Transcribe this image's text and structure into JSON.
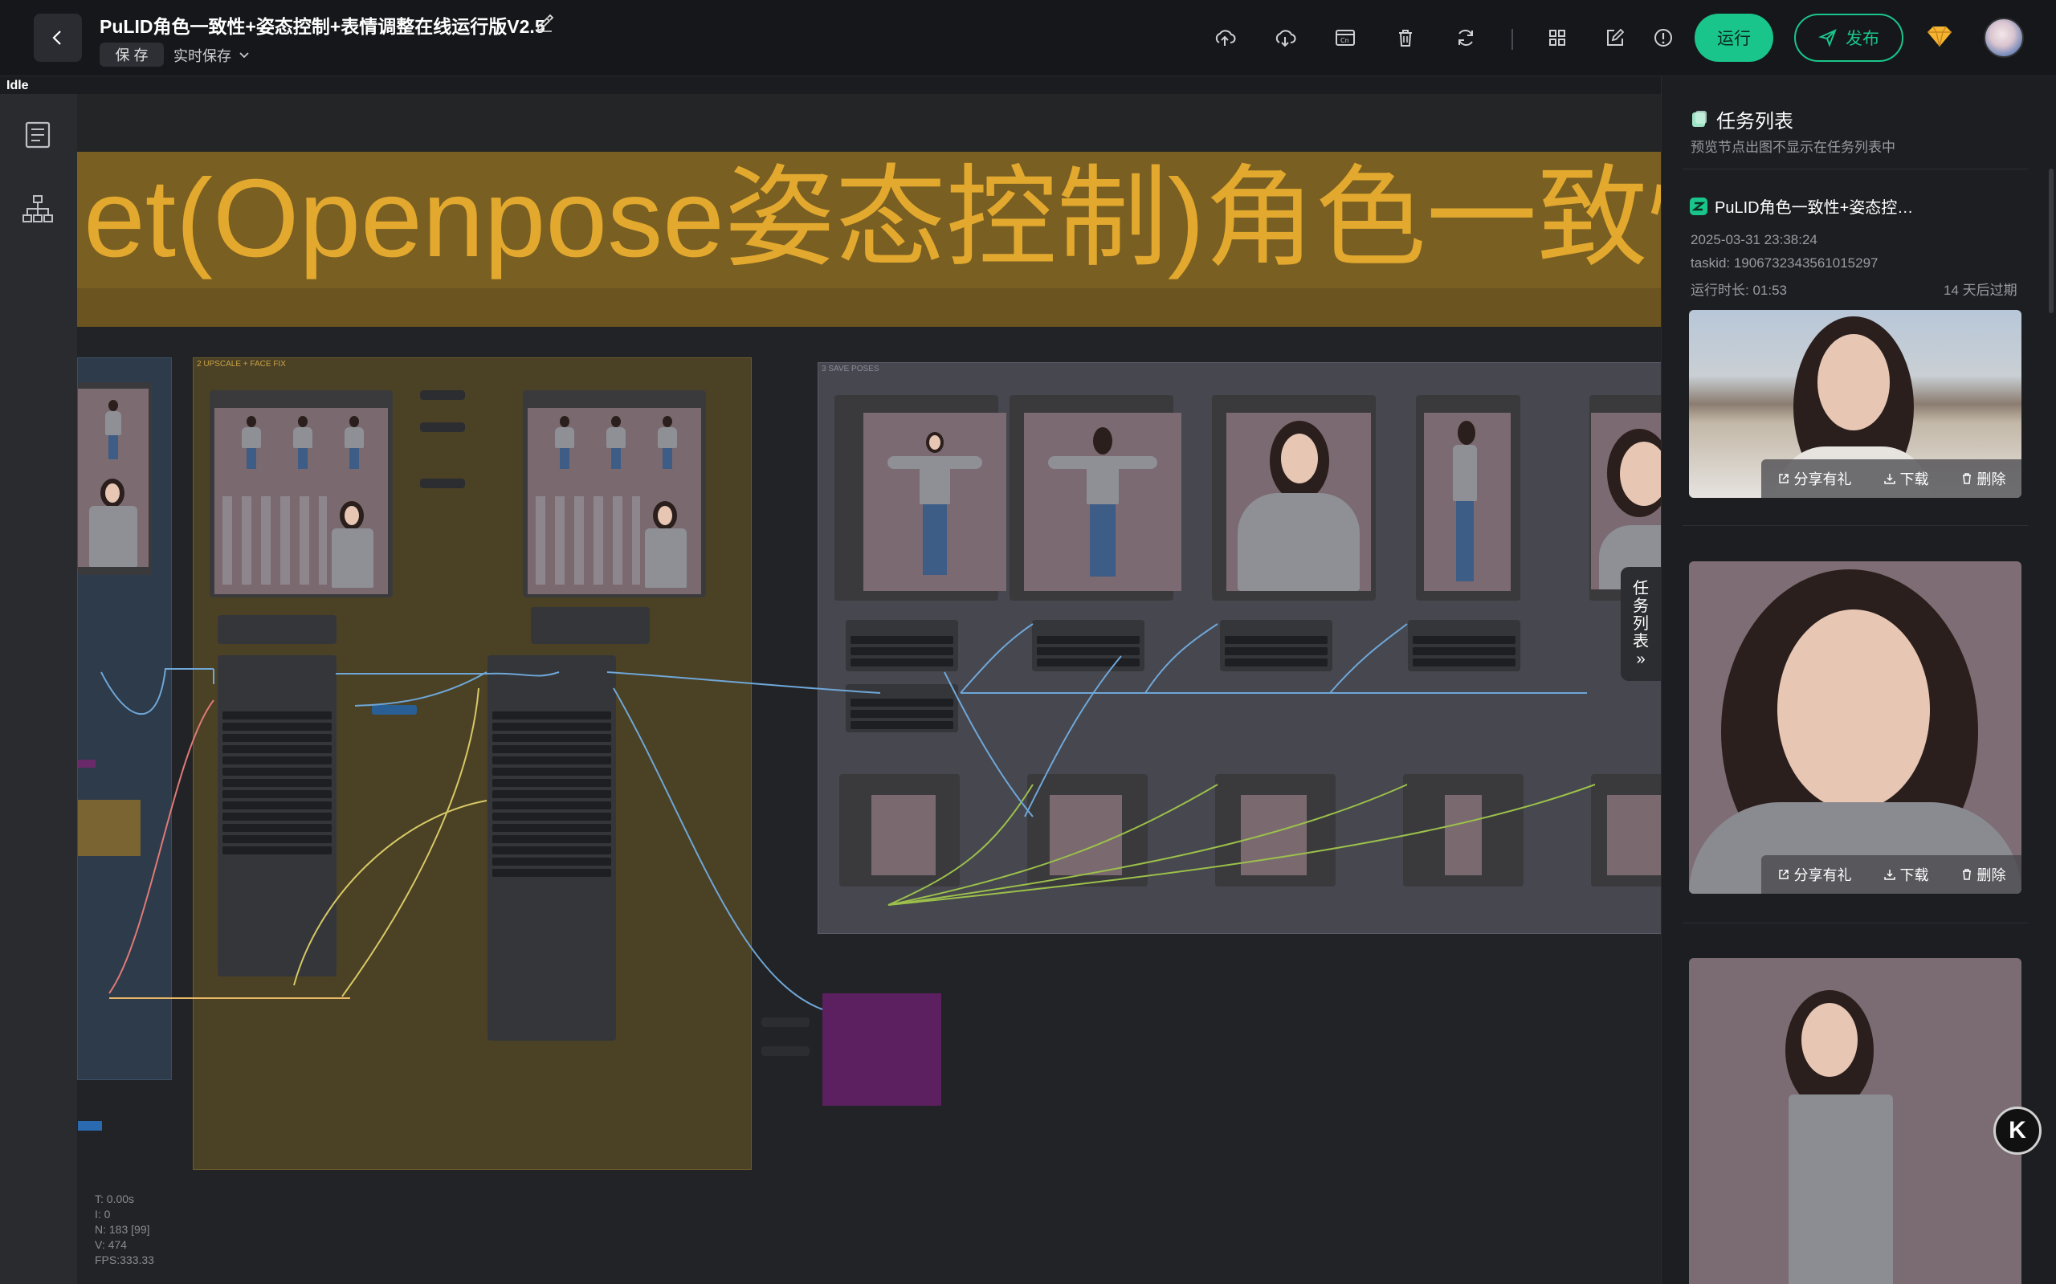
{
  "header": {
    "title": "PuLID角色一致性+姿态控制+表情调整在线运行版V2.5",
    "save_label": "保 存",
    "autosave_label": "实时保存",
    "run_label": "运行",
    "publish_label": "发布"
  },
  "status": {
    "idle": "Idle"
  },
  "canvas": {
    "banner_text": "et(Openpose姿态控制)角色一致性文",
    "group_upscale": "2 UPSCALE + FACE FIX",
    "group_save": "3 SAVE POSES",
    "stats": [
      "T: 0.00s",
      "I: 0",
      "N: 183 [99]",
      "V: 474",
      "FPS:333.33"
    ]
  },
  "task_toggle": {
    "label": [
      "任",
      "务",
      "列",
      "表",
      "»"
    ]
  },
  "panel": {
    "title": "任务列表",
    "subtitle": "预览节点出图不显示在任务列表中",
    "task": {
      "name": "PuLID角色一致性+姿态控…",
      "date": "2025-03-31 23:38:24",
      "taskid": "taskid: 1906732343561015297",
      "duration": "运行时长: 01:53",
      "expire": "14 天后过期"
    },
    "actions": {
      "share": "分享有礼",
      "download": "下载",
      "delete": "删除"
    }
  },
  "colors": {
    "accent": "#19c58a",
    "banner_text": "#e2a92e",
    "group_upscale": "#5a4a22",
    "group_save": "#4a4b56",
    "purple_node": "#5c1f5f"
  },
  "icons": [
    "back-icon",
    "edit-icon",
    "chevron-down-icon",
    "upload-icon",
    "download-cloud-icon",
    "browser-icon",
    "trash-icon",
    "refresh-icon",
    "grid-icon",
    "note-icon",
    "info-icon",
    "send-icon",
    "gem-icon",
    "document-icon",
    "hierarchy-icon"
  ]
}
